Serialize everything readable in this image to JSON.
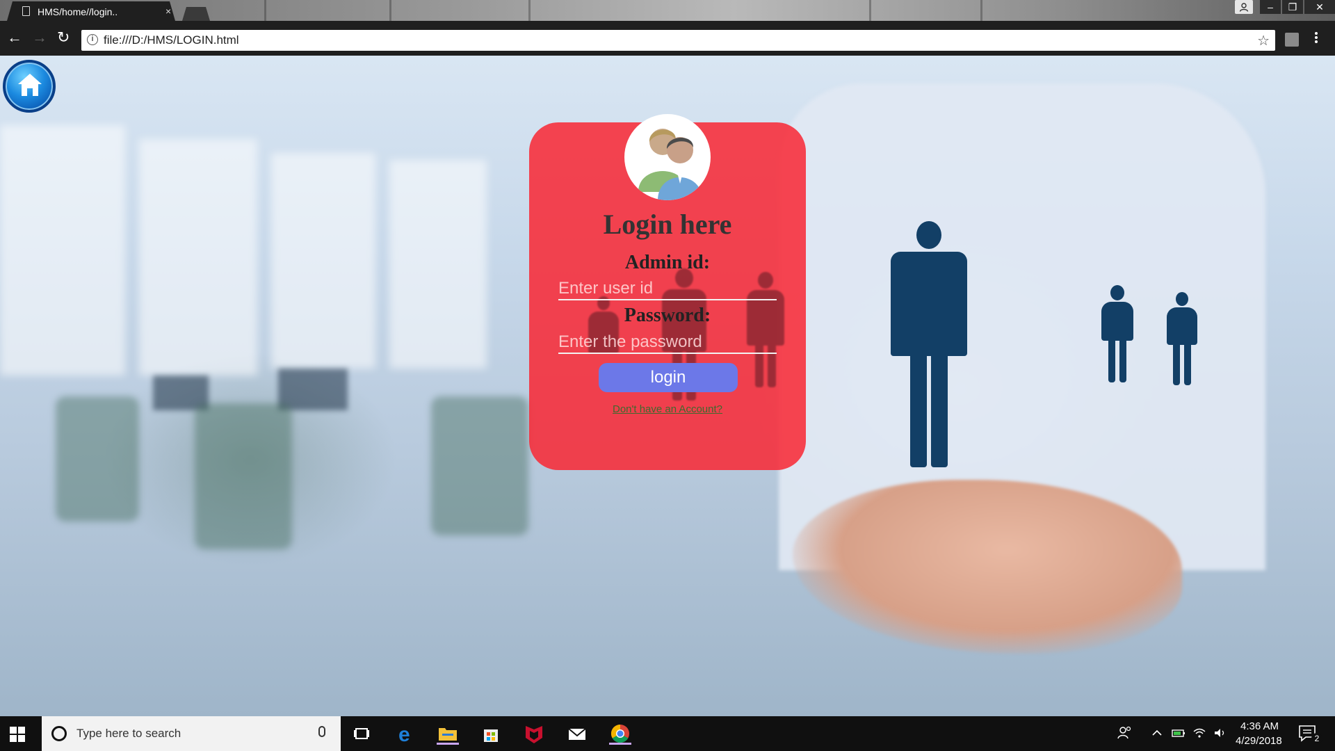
{
  "browser": {
    "tab_title": "HMS/home//login..",
    "tab_close": "×",
    "url": "file:///D:/HMS/LOGIN.html",
    "window_controls": {
      "minimize": "–",
      "maximize": "❐",
      "close": "✕"
    }
  },
  "page": {
    "home_icon": "home-icon",
    "login": {
      "title": "Login here",
      "admin_label": "Admin id:",
      "userid_placeholder": "Enter user id",
      "password_label": "Password:",
      "password_placeholder": "Enter the password",
      "button_label": "login",
      "signup_link": "Don't have an Account?"
    },
    "colors": {
      "card": "#f82834",
      "button": "#6c78e8",
      "figure": "#123f66"
    }
  },
  "taskbar": {
    "search_placeholder": "Type here to search",
    "clock_time": "4:36 AM",
    "clock_date": "4/29/2018",
    "notification_count": "2",
    "apps": [
      "task-view-icon",
      "edge-icon",
      "file-explorer-icon",
      "store-icon",
      "mcafee-icon",
      "mail-icon",
      "chrome-icon"
    ]
  }
}
